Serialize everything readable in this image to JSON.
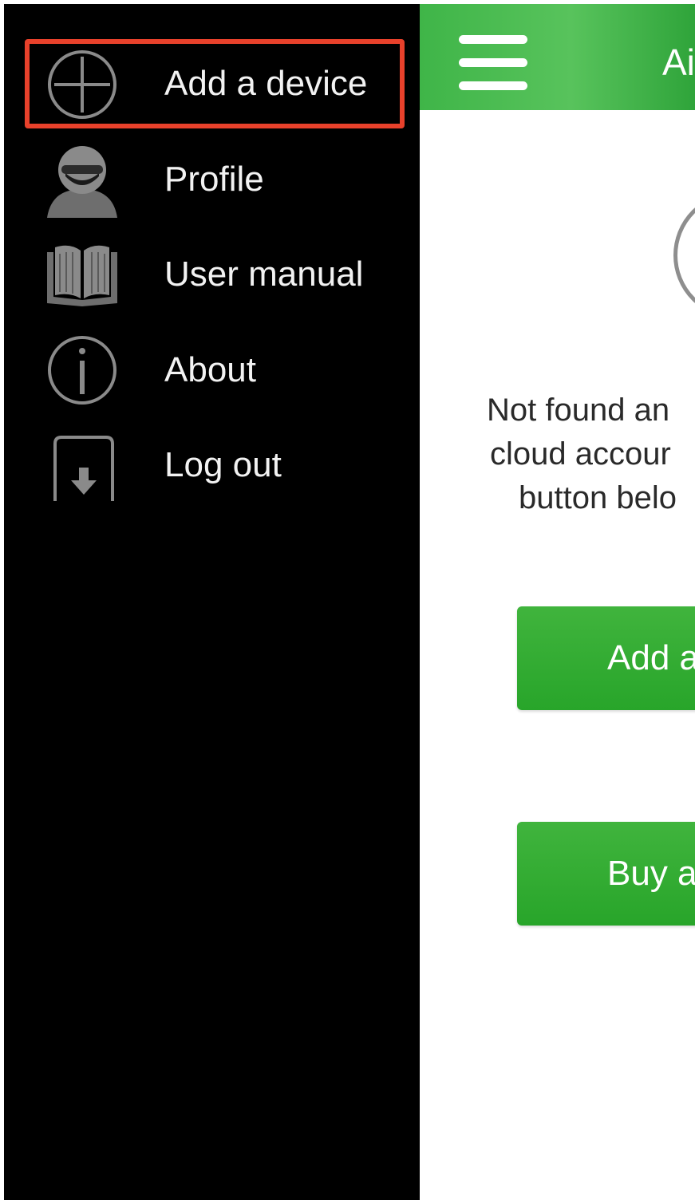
{
  "drawer": {
    "items": [
      {
        "label": "Add a device",
        "icon": "plus-circle-icon",
        "highlighted": true
      },
      {
        "label": "Profile",
        "icon": "user-icon"
      },
      {
        "label": "User manual",
        "icon": "book-icon"
      },
      {
        "label": "About",
        "icon": "info-icon"
      },
      {
        "label": "Log out",
        "icon": "logout-icon"
      }
    ],
    "highlight_color": "#e8412b"
  },
  "main": {
    "header": {
      "title": "Ai",
      "menu_icon": "hamburger-icon",
      "color": "#3fb548"
    },
    "empty_state": {
      "icon": "circle-icon",
      "message_lines": [
        "Not found an",
        "cloud accour",
        "button belo"
      ]
    },
    "buttons": [
      {
        "label": "Add a"
      },
      {
        "label": "Buy a"
      }
    ],
    "button_color": "#2fa72f"
  }
}
